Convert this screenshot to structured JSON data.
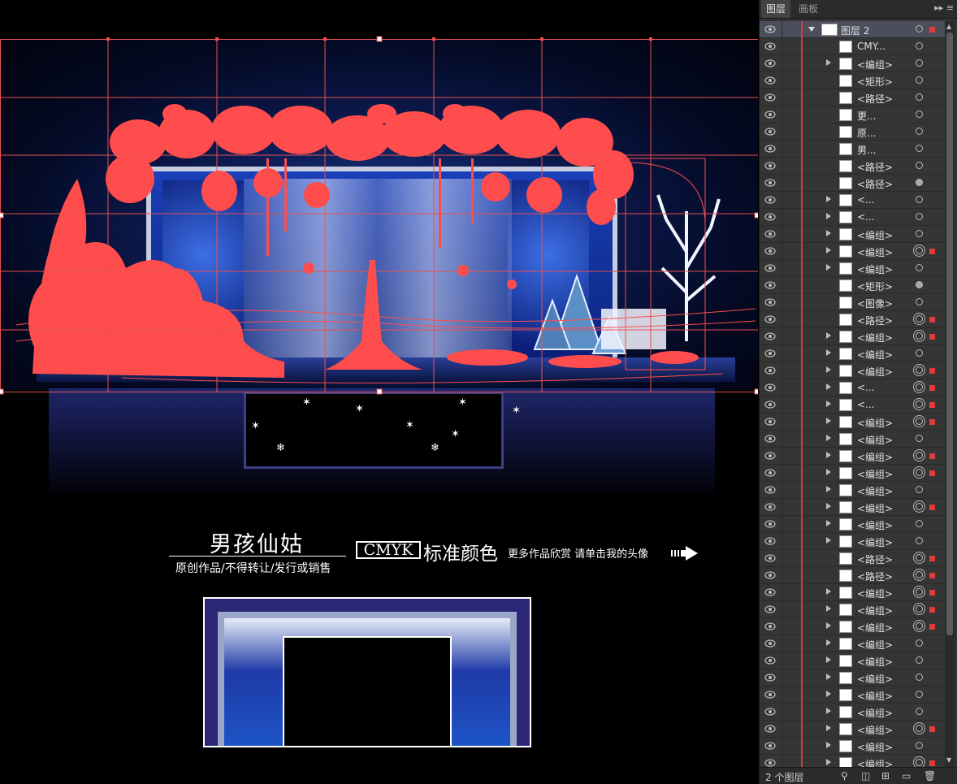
{
  "canvas": {
    "watermark": {
      "title": "男孩仙姑",
      "subtitle": "原创作品/不得转让/发行或销售",
      "cmyk": "CMYK",
      "cmyk_suffix": "标准颜色",
      "more": "更多作品欣赏 请单击我的头像"
    }
  },
  "panel": {
    "tabs": [
      {
        "label": "图层",
        "active": true
      },
      {
        "label": "画板",
        "active": false
      }
    ],
    "menu_icon": "panel-menu-icon",
    "layers": [
      {
        "name": "图层 2",
        "expander": "down",
        "target": "single",
        "sel": true
      },
      {
        "name": "CMY...",
        "expander": "none",
        "target": "single"
      },
      {
        "name": "<编组>",
        "expander": "right",
        "target": "single"
      },
      {
        "name": "<矩形>",
        "expander": "none",
        "target": "single"
      },
      {
        "name": "<路径>",
        "expander": "none",
        "target": "single"
      },
      {
        "name": "更...",
        "expander": "none",
        "target": "single"
      },
      {
        "name": "原...",
        "expander": "none",
        "target": "single"
      },
      {
        "name": "男...",
        "expander": "none",
        "target": "single"
      },
      {
        "name": "<路径>",
        "expander": "none",
        "target": "single"
      },
      {
        "name": "<路径>",
        "expander": "none",
        "target": "filled"
      },
      {
        "name": "<...",
        "expander": "right",
        "target": "single"
      },
      {
        "name": "<...",
        "expander": "right",
        "target": "single"
      },
      {
        "name": "<编组>",
        "expander": "right",
        "target": "single"
      },
      {
        "name": "<编组>",
        "expander": "right",
        "target": "double",
        "sel": true
      },
      {
        "name": "<编组>",
        "expander": "right",
        "target": "single"
      },
      {
        "name": "<矩形>",
        "expander": "none",
        "target": "filled"
      },
      {
        "name": "<图像>",
        "expander": "none",
        "target": "single"
      },
      {
        "name": "<路径>",
        "expander": "none",
        "target": "double",
        "sel": true
      },
      {
        "name": "<编组>",
        "expander": "right",
        "target": "double",
        "sel": true
      },
      {
        "name": "<编组>",
        "expander": "right",
        "target": "single"
      },
      {
        "name": "<编组>",
        "expander": "right",
        "target": "double",
        "sel": true
      },
      {
        "name": "<...",
        "expander": "right",
        "target": "double",
        "sel": true
      },
      {
        "name": "<...",
        "expander": "right",
        "target": "double",
        "sel": true
      },
      {
        "name": "<编组>",
        "expander": "right",
        "target": "double",
        "sel": true
      },
      {
        "name": "<编组>",
        "expander": "right",
        "target": "single"
      },
      {
        "name": "<编组>",
        "expander": "right",
        "target": "double",
        "sel": true
      },
      {
        "name": "<编组>",
        "expander": "right",
        "target": "double",
        "sel": true
      },
      {
        "name": "<编组>",
        "expander": "right",
        "target": "single"
      },
      {
        "name": "<编组>",
        "expander": "right",
        "target": "double",
        "sel": true
      },
      {
        "name": "<编组>",
        "expander": "right",
        "target": "single"
      },
      {
        "name": "<编组>",
        "expander": "right",
        "target": "single"
      },
      {
        "name": "<路径>",
        "expander": "none",
        "target": "double",
        "sel": true
      },
      {
        "name": "<路径>",
        "expander": "none",
        "target": "double",
        "sel": true
      },
      {
        "name": "<编组>",
        "expander": "right",
        "target": "double",
        "sel": true
      },
      {
        "name": "<编组>",
        "expander": "right",
        "target": "double",
        "sel": true
      },
      {
        "name": "<编组>",
        "expander": "right",
        "target": "double",
        "sel": true
      },
      {
        "name": "<编组>",
        "expander": "right",
        "target": "single"
      },
      {
        "name": "<编组>",
        "expander": "right",
        "target": "single"
      },
      {
        "name": "<编组>",
        "expander": "right",
        "target": "single"
      },
      {
        "name": "<编组>",
        "expander": "right",
        "target": "single"
      },
      {
        "name": "<编组>",
        "expander": "right",
        "target": "single"
      },
      {
        "name": "<编组>",
        "expander": "right",
        "target": "double",
        "sel": true
      },
      {
        "name": "<编组>",
        "expander": "right",
        "target": "single"
      },
      {
        "name": "<编组>",
        "expander": "right",
        "target": "double",
        "sel": true
      }
    ],
    "footer": {
      "count_label": "2 个图层",
      "icons": [
        "search-icon",
        "make-clip-mask-icon",
        "new-sublayer-icon",
        "new-layer-icon",
        "delete-icon"
      ]
    }
  },
  "colors": {
    "selection": "#e23b3b",
    "panel_bg": "#323232",
    "row_selected": "#4b4f5c",
    "scene_blue": "#1a3fb8"
  }
}
